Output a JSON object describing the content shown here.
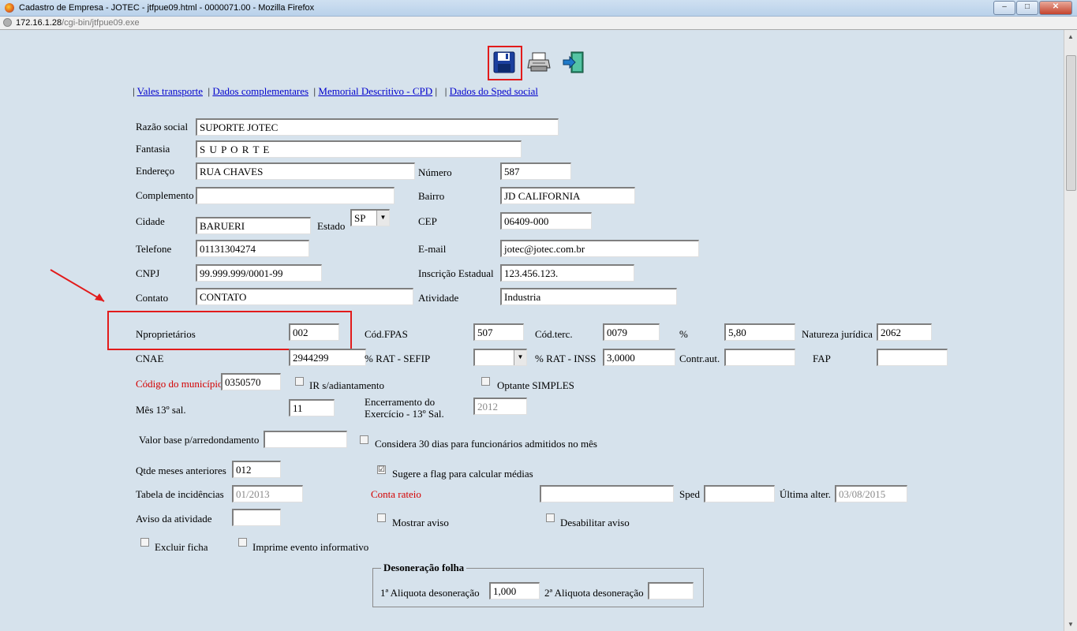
{
  "window": {
    "title": "Cadastro de Empresa - JOTEC - jtfpue09.html - 0000071.00 - Mozilla Firefox",
    "url_host": "172.16.1.28",
    "url_path": "/cgi-bin/jtfpue09.exe",
    "min_label": "–",
    "max_label": "□",
    "close_label": "✕"
  },
  "toolbar": {
    "save": "save-icon",
    "print": "printer-icon",
    "exit": "exit-door-icon"
  },
  "links": {
    "sep": "|",
    "vales": "Vales transporte",
    "dados_compl": "Dados complementares",
    "memorial": "Memorial Descritivo - CPD",
    "sped_social": "Dados do Sped social"
  },
  "form": {
    "razao_social": {
      "label": "Razão social",
      "value": "SUPORTE  JOTEC"
    },
    "fantasia": {
      "label": "Fantasia",
      "value": "S U P O R T E"
    },
    "endereco": {
      "label": "Endereço",
      "value": "RUA CHAVES"
    },
    "numero": {
      "label": "Número",
      "value": "587"
    },
    "complemento": {
      "label": "Complemento",
      "value": ""
    },
    "bairro": {
      "label": "Bairro",
      "value": "JD CALIFORNIA"
    },
    "cidade": {
      "label": "Cidade",
      "value": "BARUERI"
    },
    "estado": {
      "label": "Estado",
      "value": "SP"
    },
    "cep": {
      "label": "CEP",
      "value": "06409-000"
    },
    "telefone": {
      "label": "Telefone",
      "value": "01131304274"
    },
    "email": {
      "label": "E-mail",
      "value": "jotec@jotec.com.br"
    },
    "cnpj": {
      "label": "CNPJ",
      "value": "99.999.999/0001-99"
    },
    "inscricao": {
      "label": "Inscrição Estadual",
      "value": "123.456.123."
    },
    "contato": {
      "label": "Contato",
      "value": "CONTATO"
    },
    "atividade": {
      "label": "Atividade",
      "value": "Industria"
    },
    "nproprietarios": {
      "label": "Nproprietários",
      "value": "002"
    },
    "cod_fpas": {
      "label": "Cód.FPAS",
      "value": "507"
    },
    "cod_terc": {
      "label": "Cód.terc.",
      "value": "0079"
    },
    "percent": {
      "label": "%",
      "value": "5,80"
    },
    "natureza": {
      "label": "Natureza jurídica",
      "value": "2062"
    },
    "cnae": {
      "label": "CNAE",
      "value": "2944299"
    },
    "rat_sefip": {
      "label": "% RAT - SEFIP",
      "value": ""
    },
    "rat_inss": {
      "label": "% RAT - INSS",
      "value": "3,0000"
    },
    "contr_aut": {
      "label": "Contr.aut.",
      "value": ""
    },
    "fap": {
      "label": "FAP",
      "value": ""
    },
    "cod_municipio": {
      "label": "Código do município",
      "value": "0350570"
    },
    "ir_adiant": {
      "label": "IR s/adiantamento"
    },
    "optante": {
      "label": "Optante SIMPLES"
    },
    "mes13": {
      "label": "Mês 13º sal.",
      "value": "11"
    },
    "encerramento": {
      "label1": "Encerramento do",
      "label2": "Exercício - 13º Sal.",
      "value": "2012"
    },
    "valor_base": {
      "label": "Valor base p/arredondamento",
      "value": ""
    },
    "considera30": {
      "label": "Considera 30 dias para funcionários admitidos no mês"
    },
    "qtde_meses": {
      "label": "Qtde meses anteriores",
      "value": "012"
    },
    "sugere_flag": {
      "label": "Sugere a flag para calcular médias",
      "checked": "☑"
    },
    "tabela_incid": {
      "label": "Tabela de incidências",
      "value": "01/2013"
    },
    "conta_rateio": {
      "label": "Conta rateio",
      "value": ""
    },
    "sped": {
      "label": "Sped",
      "value": ""
    },
    "ultima_alter": {
      "label": "Última alter.",
      "value": "03/08/2015"
    },
    "aviso_ativ": {
      "label": "Aviso da atividade",
      "value": ""
    },
    "mostrar_aviso": {
      "label": "Mostrar aviso"
    },
    "desabilitar_aviso": {
      "label": "Desabilitar aviso"
    },
    "excluir_ficha": {
      "label": "Excluir ficha"
    },
    "imprime_evento": {
      "label": "Imprime evento informativo"
    },
    "desoneracao": {
      "legend": "Desoneração folha",
      "aliq1_label": "1ª Aliquota desoneração",
      "aliq1_value": "1,000",
      "aliq2_label": "2ª Aliquota desoneração",
      "aliq2_value": ""
    }
  }
}
